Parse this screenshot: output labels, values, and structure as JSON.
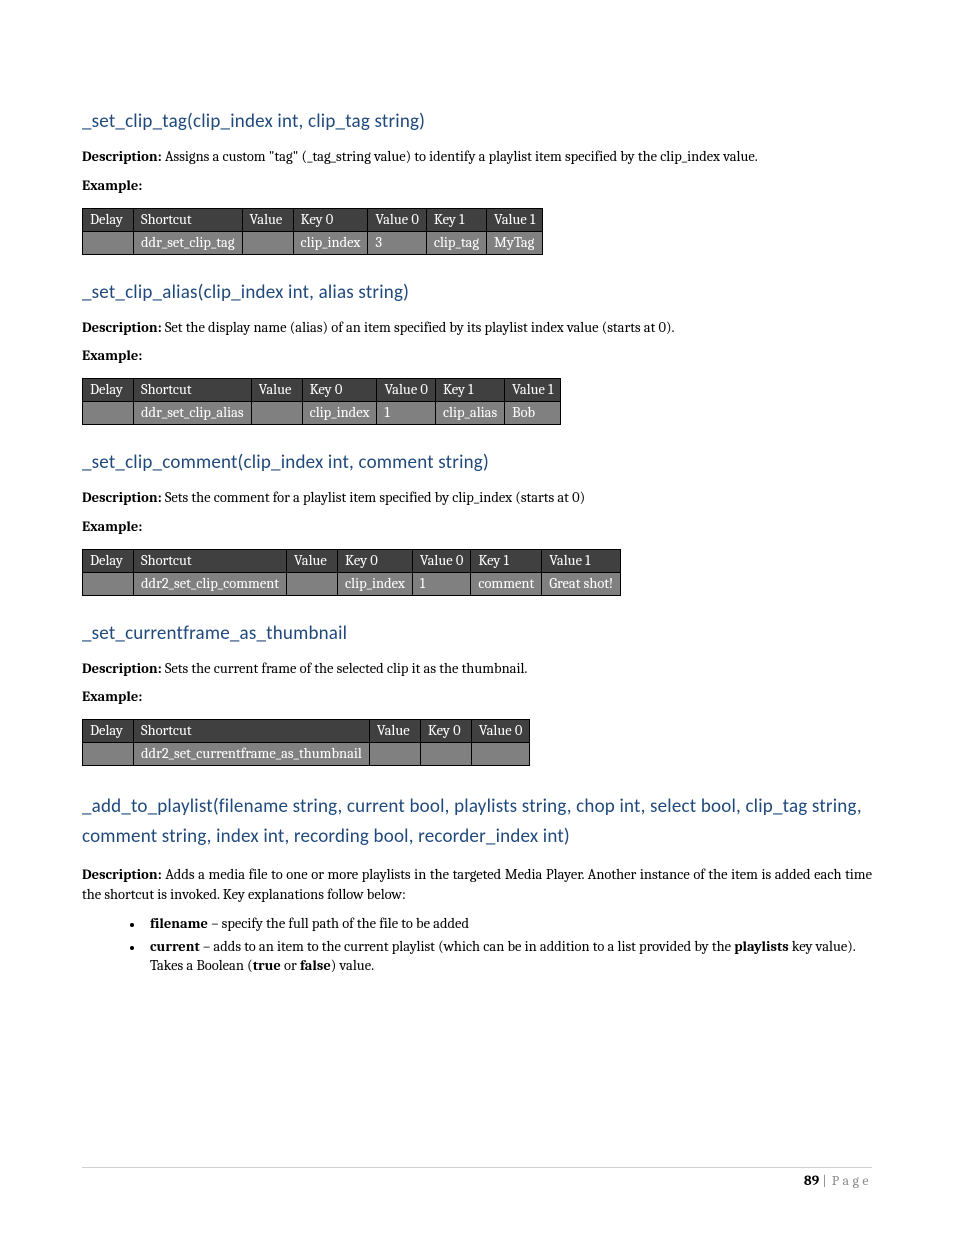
{
  "sections": [
    {
      "heading": "_set_clip_tag(clip_index int, clip_tag string)",
      "desc_pre": "Description:",
      "desc": " Assigns a custom \"tag\" (_tag_string value) to identify a playlist item specified by the clip_index value.",
      "example_label": "Example:",
      "table": {
        "headers": [
          "Delay",
          "Shortcut",
          "Value",
          "Key 0",
          "Value 0",
          "Key 1",
          "Value 1"
        ],
        "row": [
          "",
          "ddr_set_clip_tag",
          "",
          "clip_index",
          "3",
          "clip_tag",
          "MyTag"
        ]
      }
    },
    {
      "heading": "_set_clip_alias(clip_index int, alias string)",
      "desc_pre": "Description:",
      "desc": " Set the display name (alias) of an item specified by its playlist index value (starts at 0).",
      "example_label": "Example:",
      "table": {
        "headers": [
          "Delay",
          "Shortcut",
          "Value",
          "Key 0",
          "Value 0",
          "Key 1",
          "Value 1"
        ],
        "row": [
          "",
          "ddr_set_clip_alias",
          "",
          "clip_index",
          "1",
          "clip_alias",
          "Bob"
        ]
      }
    },
    {
      "heading": "_set_clip_comment(clip_index int, comment string)",
      "desc_pre": "Description:",
      "desc": " Sets the comment for a playlist item specified by clip_index (starts at 0)",
      "example_label": "Example:",
      "table": {
        "headers": [
          "Delay",
          "Shortcut",
          "Value",
          "Key 0",
          "Value 0",
          "Key 1",
          "Value 1"
        ],
        "row": [
          "",
          "ddr2_set_clip_comment",
          "",
          "clip_index",
          "1",
          "comment",
          "Great shot!"
        ]
      }
    },
    {
      "heading": "_set_currentframe_as_thumbnail",
      "desc_pre": "Description:",
      "desc": " Sets the current frame of the selected clip it as the thumbnail.",
      "example_label": "Example:",
      "table": {
        "headers": [
          "Delay",
          "Shortcut",
          "Value",
          "Key 0",
          "Value 0"
        ],
        "row": [
          "",
          "ddr2_set_currentframe_as_thumbnail",
          "",
          "",
          ""
        ]
      }
    }
  ],
  "add_to_playlist": {
    "heading": "_add_to_playlist(filename string, current bool, playlists string, chop int, select bool, clip_tag string, comment string, index int, recording bool, recorder_index int)",
    "desc_pre": "Description:",
    "desc": " Adds a media file to one or more playlists in the targeted Media Player. Another instance of the item is added each time the shortcut is invoked.  Key explanations follow below:",
    "bullets": {
      "b1_key": "filename",
      "b1_rest": " – specify the full path of the file to be added",
      "b2_key": "current",
      "b2_mid": " – adds to an item to the current playlist (which can be in addition to a list provided by the ",
      "b2_key2": "playlists",
      "b2_mid2": " key value). Takes a Boolean (",
      "b2_true": "true",
      "b2_or": " or ",
      "b2_false": "false",
      "b2_end": ") value."
    }
  },
  "footer": {
    "page_num": "89",
    "sep": " | ",
    "label": "Page"
  }
}
